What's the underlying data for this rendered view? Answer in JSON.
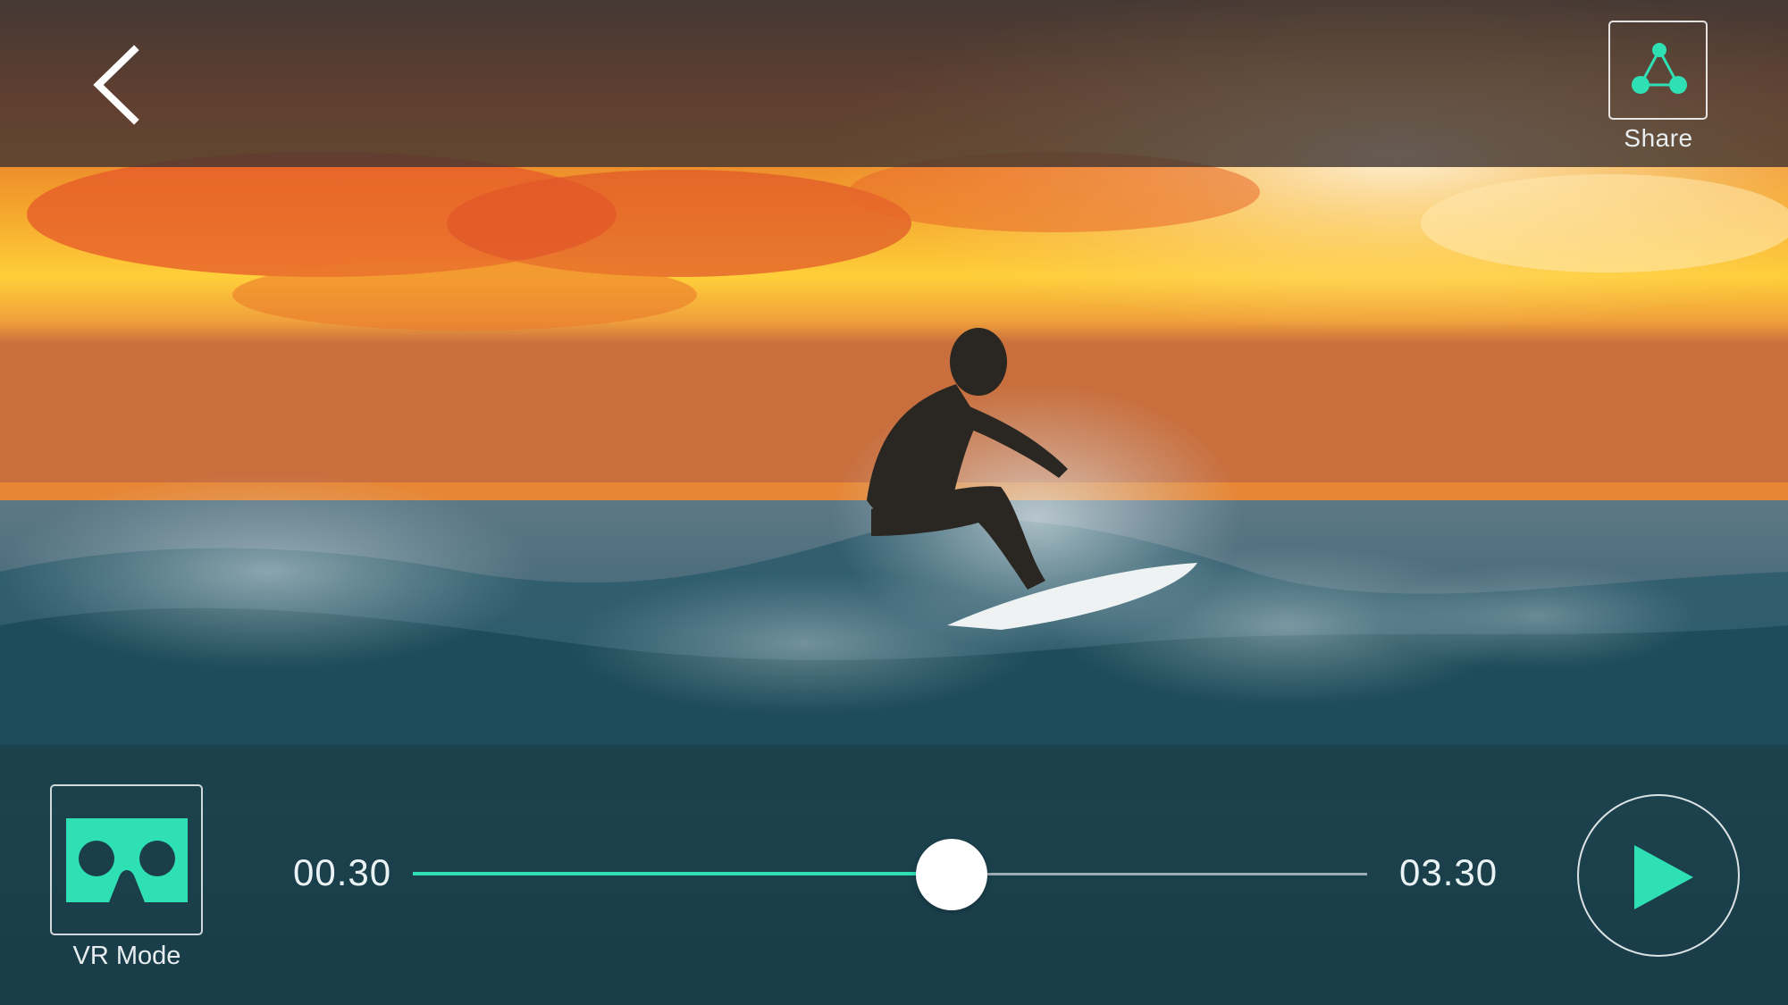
{
  "header": {
    "share_label": "Share"
  },
  "controls": {
    "vr_mode_label": "VR Mode",
    "current_time": "00.30",
    "total_time": "03.30",
    "progress": 0.565
  },
  "icons": {
    "back": "chevron-left-icon",
    "share": "share-nodes-icon",
    "vr": "vr-headset-icon",
    "play": "play-triangle-icon"
  },
  "colors": {
    "accent": "#2fe0b4",
    "top_bar": "#403432",
    "control_bar": "#1a3e4a",
    "label_text": "#e8eef0"
  }
}
